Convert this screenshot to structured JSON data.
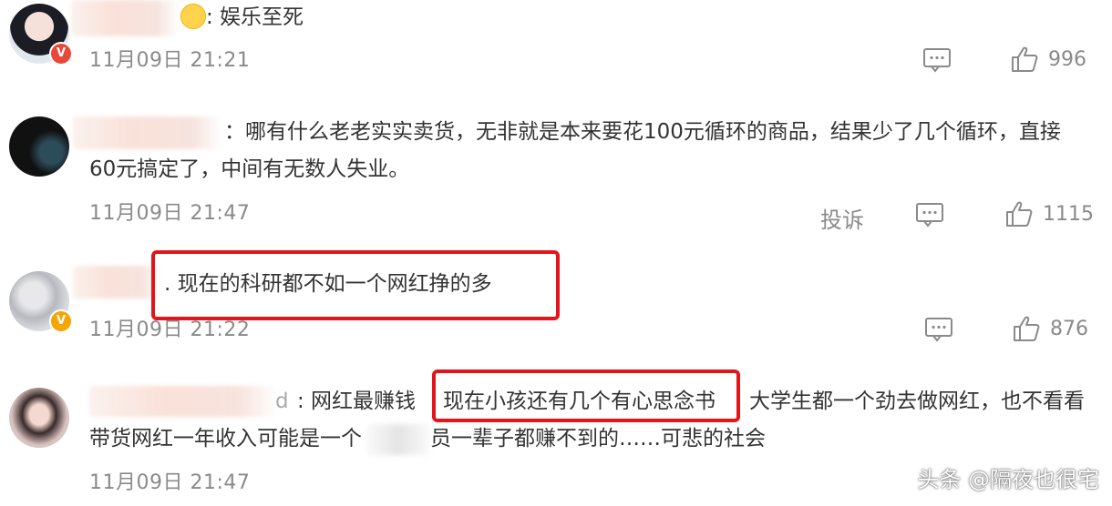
{
  "comments": [
    {
      "text": ": 娱乐至死",
      "timestamp": "11月09日 21:21",
      "like_count": "996"
    },
    {
      "text_line1": "：哪有什么老老实实卖货，无非就是本来要花100元循环的商品，结果少了几个循环，直接",
      "text_line2": "60元搞定了，中间有无数人失业。",
      "timestamp": "11月09日 21:47",
      "report_label": "投诉",
      "like_count": "1115"
    },
    {
      "text": ". 现在的科研都不如一个网红挣的多",
      "timestamp": "11月09日 21:22",
      "like_count": "876"
    },
    {
      "name_tail": "d",
      "text_a": ": 网红最赚钱",
      "text_highlight": "现在小孩还有几个有心思念书",
      "text_b": "大学生都一个劲去做网红，也不看看",
      "text_line2_a": "带货网红一年收入可能是一个",
      "text_line2_b": "员一辈子都赚不到的……可悲的社会",
      "timestamp": "11月09日 21:47"
    }
  ],
  "watermark": "头条 @隔夜也很宅",
  "colors": {
    "highlight_border": "#e3151b",
    "timestamp": "#8a8a8a",
    "verified_gold": "#f5a500",
    "verified_red": "#e7483a"
  }
}
